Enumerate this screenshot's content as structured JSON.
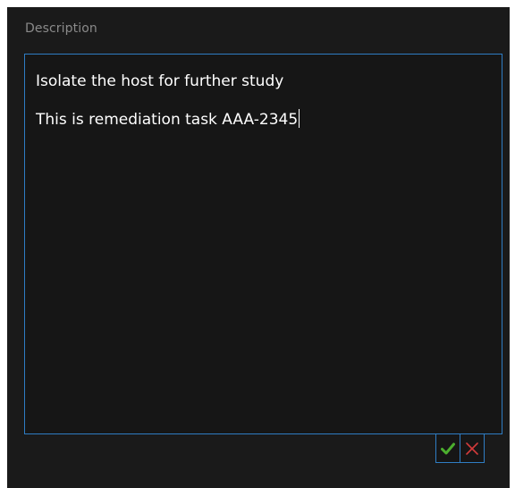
{
  "field": {
    "label": "Description",
    "lines": [
      "Isolate the host for further study",
      "This is remediation task AAA-2345"
    ]
  },
  "actions": {
    "confirm_icon": "check-icon",
    "cancel_icon": "x-icon"
  },
  "colors": {
    "panel_bg": "#1a1a1a",
    "accent_border": "#2f7dc4",
    "confirm": "#4caf2e",
    "cancel": "#d23b3b",
    "label_text": "#8a8a8a",
    "body_text": "#ffffff"
  }
}
